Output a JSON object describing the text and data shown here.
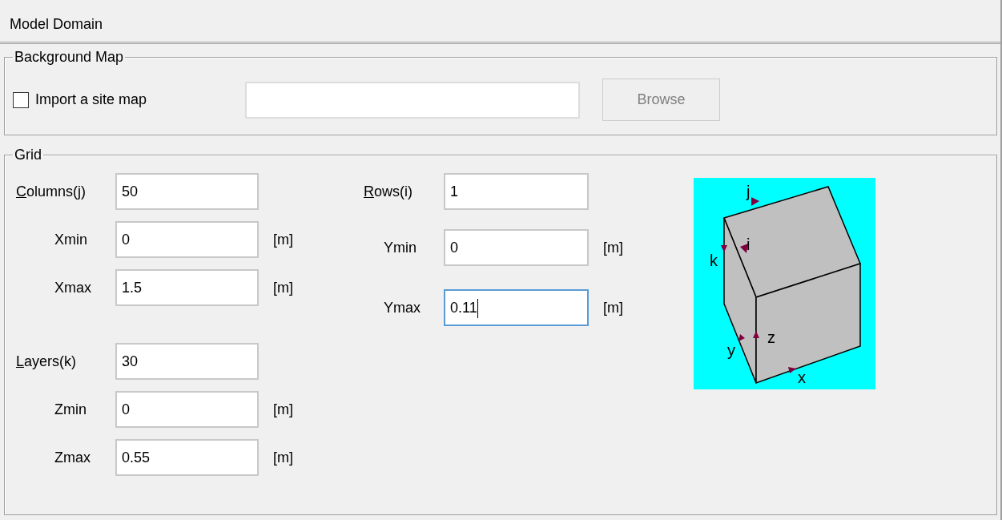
{
  "title": "Model Domain",
  "background_map": {
    "title": "Background Map",
    "checkbox": {
      "label": "Import a site map",
      "checked": false
    },
    "browse_button": {
      "label": "Browse",
      "disabled": true
    }
  },
  "grid": {
    "title": "Grid",
    "left_groups": [
      [
        {
          "kind": "count",
          "label": "Columns(j)",
          "underline_first": true,
          "value": "50",
          "focused": false
        },
        {
          "kind": "bound",
          "label": "Xmin",
          "value": "0",
          "unit": "[m]",
          "focused": false
        },
        {
          "kind": "bound",
          "label": "Xmax",
          "value": "1.5",
          "unit": "[m]",
          "focused": false
        }
      ],
      [
        {
          "kind": "count",
          "label": "Layers(k)",
          "underline_first": true,
          "value": "30",
          "focused": false
        },
        {
          "kind": "bound",
          "label": "Zmin",
          "value": "0",
          "unit": "[m]",
          "focused": false
        },
        {
          "kind": "bound",
          "label": "Zmax",
          "value": "0.55",
          "unit": "[m]",
          "focused": false
        }
      ]
    ],
    "right_group": [
      {
        "kind": "count",
        "label": "Rows(i)",
        "underline_first": true,
        "value": "1",
        "focused": false
      },
      {
        "kind": "bound",
        "label": "Ymin",
        "value": "0",
        "unit": "[m]",
        "focused": false
      },
      {
        "kind": "bound",
        "label": "Ymax",
        "value": "0.11",
        "unit": "[m]",
        "focused": true
      }
    ],
    "diagram": {
      "axis_labels": [
        "j",
        "i",
        "k",
        "z",
        "y",
        "x"
      ]
    }
  }
}
